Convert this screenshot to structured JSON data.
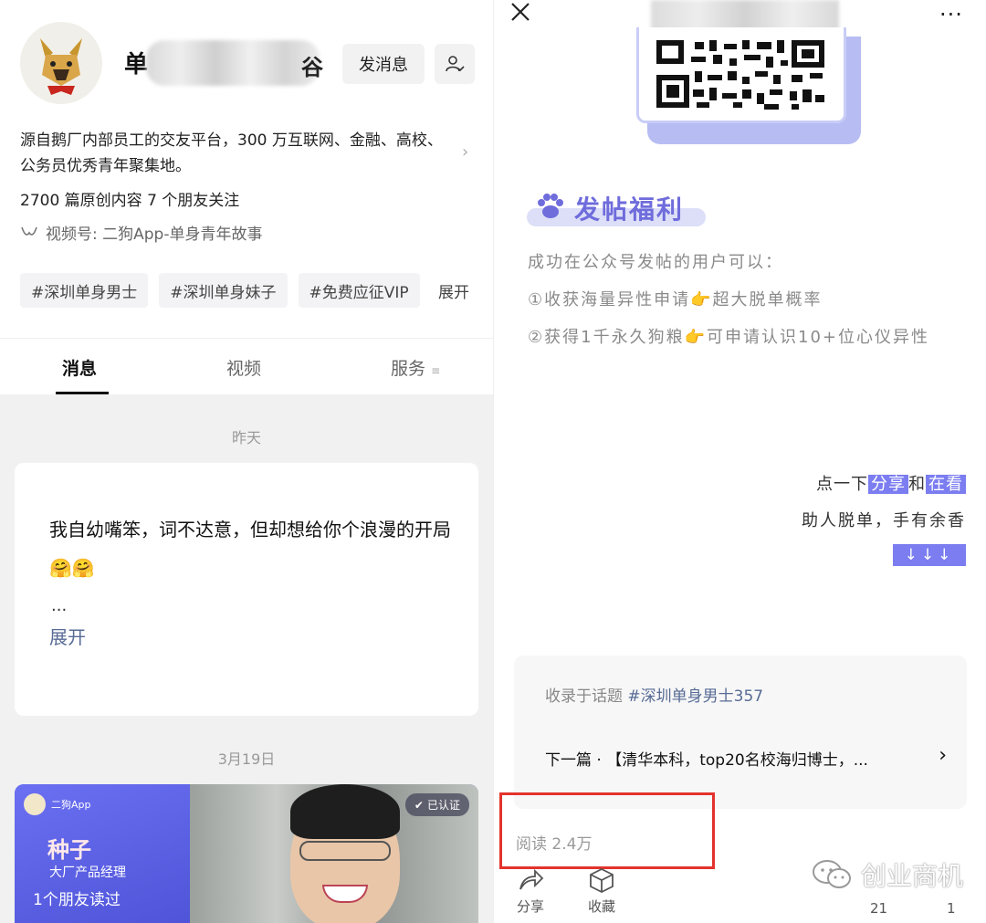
{
  "left": {
    "account": {
      "name_start": "单",
      "name_end": "谷"
    },
    "message_button": "发消息",
    "intro": "源自鹅厂内部员工的交友平台，300 万互联网、金融、高校、公务员优秀青年聚集地。",
    "stats": "2700 篇原创内容   7 个朋友关注",
    "video_channel": "视频号: 二狗App-单身青年故事",
    "tags": [
      "#深圳单身男士",
      "#深圳单身妹子",
      "#免费应征VIP"
    ],
    "tags_expand": "展开",
    "tabs": [
      "消息",
      "视频",
      "服务"
    ],
    "feed": {
      "date1": "昨天",
      "message": "我自幼嘴笨，词不达意，但却想给你个浪漫的开局🤗🤗",
      "ellipsis": "...",
      "expand": "展开",
      "date2": "3月19日",
      "article": {
        "brand": "二狗App",
        "seed": "种子",
        "role": "大厂产品经理",
        "friends_read": "1个朋友读过",
        "verified": "已认证"
      }
    }
  },
  "right": {
    "perks_title": "发帖福利",
    "perks_intro": "成功在公众号发帖的用户可以：",
    "perk1": "①收获海量异性申请👉超大脱单概率",
    "perk2": "②获得1千永久狗粮👉可申请认识10+位心仪异性",
    "share_prefix": "点一下",
    "share_word": "分享",
    "share_and": "和",
    "look_word": "在看",
    "help_line": "助人脱单，手有余香",
    "arrows": "↓↓↓",
    "topic_prefix": "收录于话题",
    "topic_name": "#深圳单身男士",
    "topic_count": "357",
    "next_label": "下一篇 · 【清华本科，top20名校海归博士，...",
    "next_chevron": "›",
    "reads": "阅读 2.4万",
    "share_action": "分享",
    "fav_action": "收藏",
    "like_count": "21",
    "look_count": "1",
    "watermark": "创业商机"
  },
  "colors": {
    "accent": "#7b7df0",
    "link": "#576b95",
    "highlight_box": "#e3332c"
  }
}
